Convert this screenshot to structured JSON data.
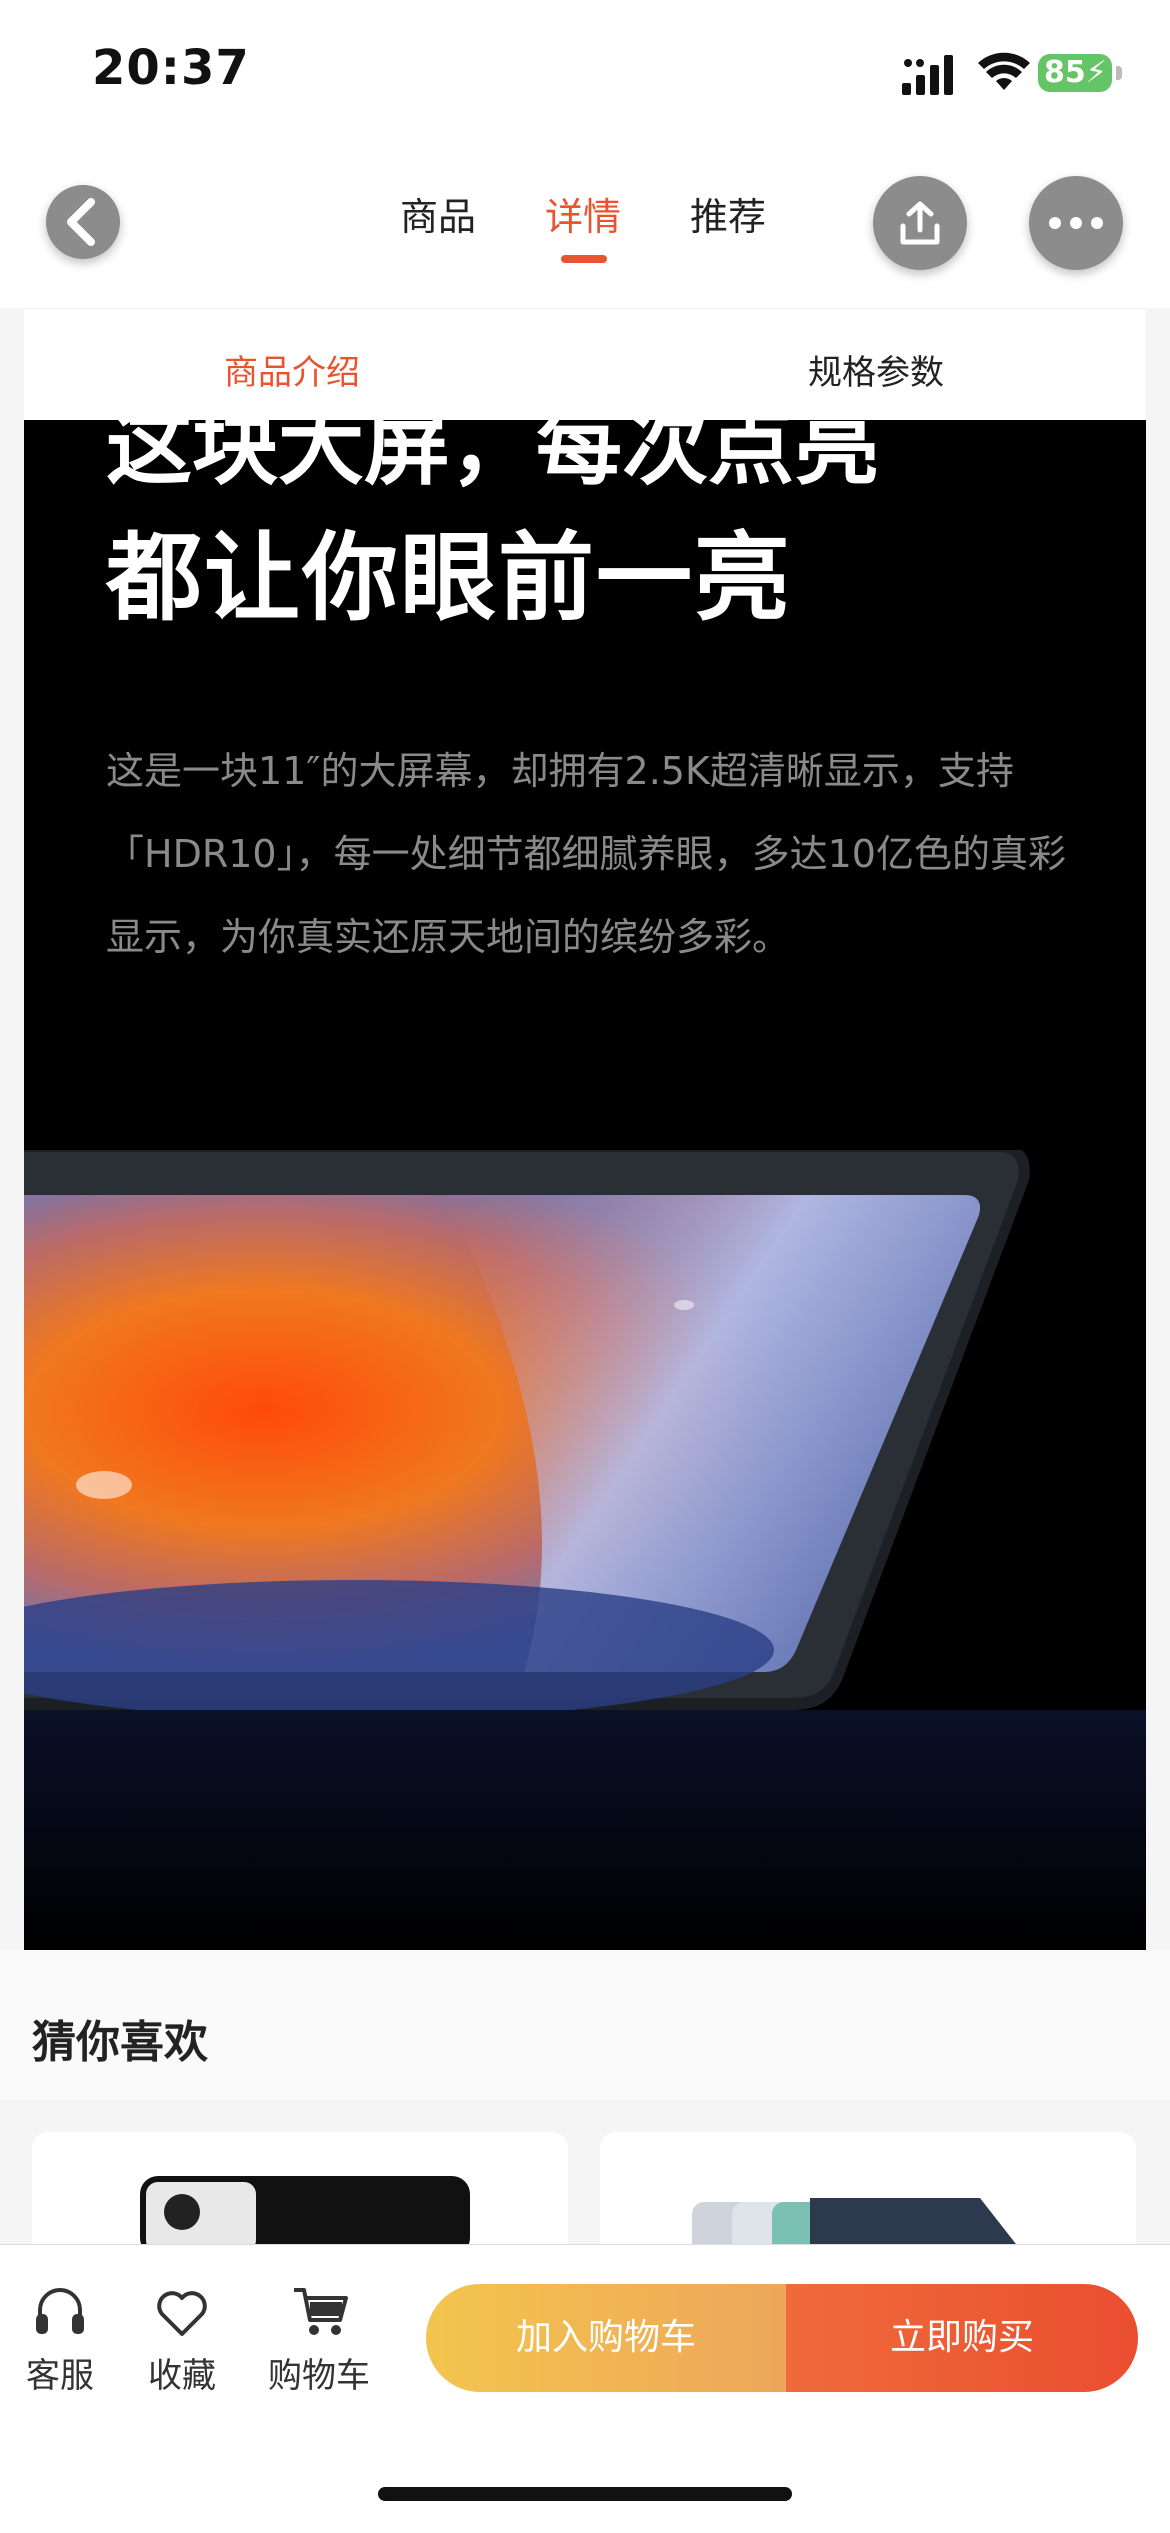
{
  "status_bar": {
    "time": "20:37",
    "battery": "85"
  },
  "header": {
    "tabs": [
      {
        "label": "商品",
        "active": false
      },
      {
        "label": "详情",
        "active": true
      },
      {
        "label": "推荐",
        "active": false
      }
    ],
    "accent_color": "#e9542f"
  },
  "subtabs": [
    {
      "label": "商品介绍",
      "active": true
    },
    {
      "label": "规格参数",
      "active": false
    }
  ],
  "hero": {
    "headline_partial": "这块大屏，每次点亮",
    "headline": "都让你眼前一亮",
    "body": "这是一块11″的大屏幕，却拥有2.5K超清晰显示，支持「HDR10」，每一处细节都细腻养眼，多达10亿色的真彩显示，为你真实还原天地间的缤纷多彩。"
  },
  "recommend": {
    "title": "猜你喜欢"
  },
  "bottom_bar": {
    "service_label": "客服",
    "favorite_label": "收藏",
    "cart_label": "购物车",
    "add_to_cart": "加入购物车",
    "buy_now": "立即购买"
  }
}
